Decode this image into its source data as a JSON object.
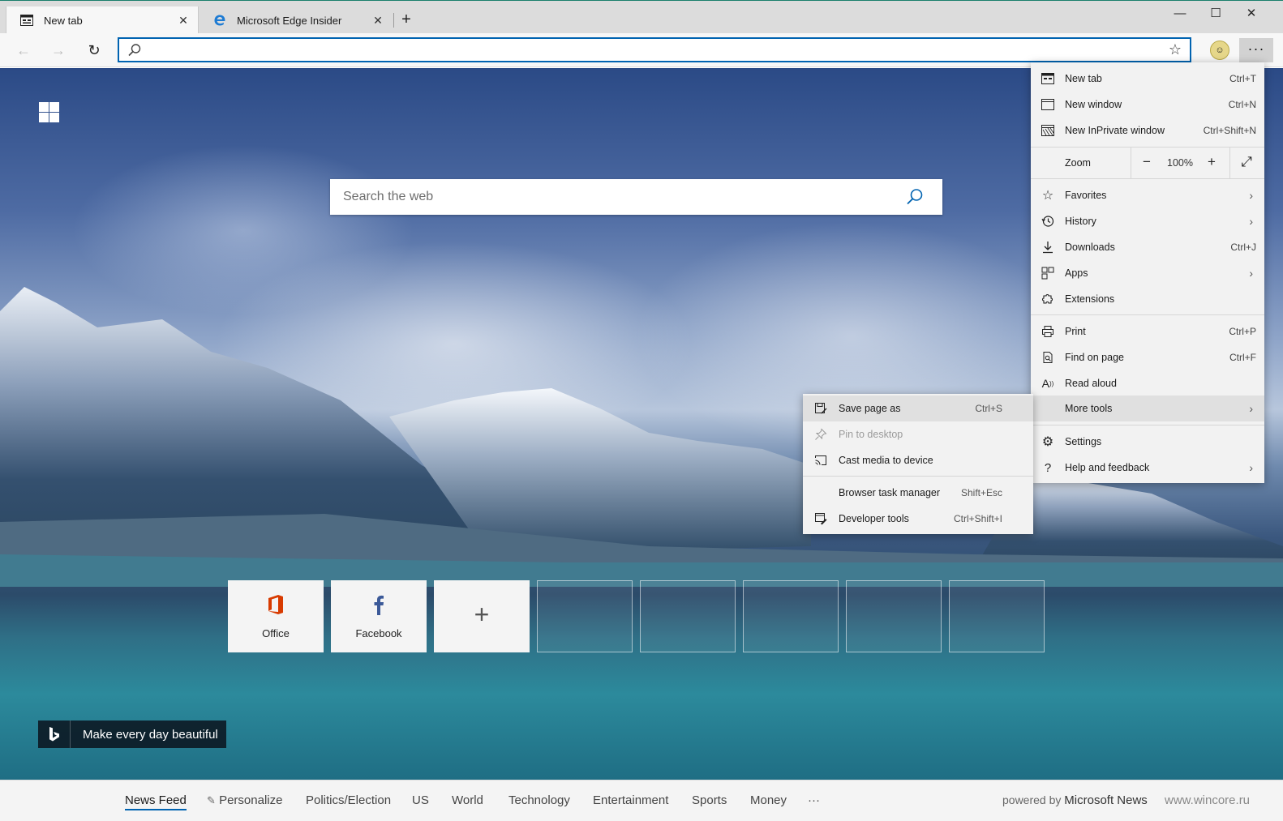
{
  "tabs": [
    {
      "title": "New tab",
      "active": true,
      "icon": "newtab-page-icon"
    },
    {
      "title": "Microsoft Edge Insider",
      "active": false,
      "icon": "edge-logo-icon"
    }
  ],
  "window_controls": {
    "minimize": "—",
    "maximize": "☐",
    "close": "✕"
  },
  "toolbar": {
    "back": "←",
    "forward": "→",
    "refresh": "↻",
    "address_value": "",
    "favorite_star": "☆",
    "more": "···"
  },
  "new_tab_page": {
    "search_placeholder": "Search the web",
    "top_sites": [
      {
        "label": "Office",
        "type": "site"
      },
      {
        "label": "Facebook",
        "type": "site"
      },
      {
        "label": "+",
        "type": "add"
      },
      {
        "label": "",
        "type": "empty"
      },
      {
        "label": "",
        "type": "empty"
      },
      {
        "label": "",
        "type": "empty"
      },
      {
        "label": "",
        "type": "empty"
      },
      {
        "label": "",
        "type": "empty"
      }
    ],
    "bing_caption": "Make every day beautiful"
  },
  "news_bar": {
    "items": [
      "News Feed",
      "Personalize",
      "Politics/Election",
      "US",
      "World",
      "Technology",
      "Entertainment",
      "Sports",
      "Money",
      "···"
    ],
    "active": "News Feed",
    "powered_prefix": "powered by",
    "powered_brand": "Microsoft News",
    "watermark": "www.wincore.ru"
  },
  "menu": {
    "items": [
      {
        "label": "New tab",
        "shortcut": "Ctrl+T",
        "icon": "new-tab-icon"
      },
      {
        "label": "New window",
        "shortcut": "Ctrl+N",
        "icon": "window-icon"
      },
      {
        "label": "New InPrivate window",
        "shortcut": "Ctrl+Shift+N",
        "icon": "inprivate-icon"
      },
      {
        "label": "Favorites",
        "chevron": "›",
        "icon": "star-icon"
      },
      {
        "label": "History",
        "chevron": "›",
        "icon": "history-icon"
      },
      {
        "label": "Downloads",
        "shortcut": "Ctrl+J",
        "icon": "download-icon"
      },
      {
        "label": "Apps",
        "chevron": "›",
        "icon": "apps-icon"
      },
      {
        "label": "Extensions",
        "icon": "puzzle-icon"
      },
      {
        "label": "Print",
        "shortcut": "Ctrl+P",
        "icon": "print-icon"
      },
      {
        "label": "Find on page",
        "shortcut": "Ctrl+F",
        "icon": "find-icon"
      },
      {
        "label": "Read aloud",
        "icon": "read-aloud-icon"
      },
      {
        "label": "More tools",
        "chevron": "›",
        "icon": ""
      },
      {
        "label": "Settings",
        "icon": "gear-icon"
      },
      {
        "label": "Help and feedback",
        "chevron": "›",
        "icon": "question-icon"
      }
    ],
    "zoom": {
      "label": "Zoom",
      "minus": "−",
      "value": "100%",
      "plus": "+",
      "fullscreen": "⤢"
    }
  },
  "submenu": {
    "items": [
      {
        "label": "Save page as",
        "shortcut": "Ctrl+S",
        "icon": "save-page-icon",
        "enabled": true
      },
      {
        "label": "Pin to desktop",
        "shortcut": "",
        "icon": "pin-icon",
        "enabled": false
      },
      {
        "label": "Cast media to device",
        "shortcut": "",
        "icon": "cast-icon",
        "enabled": true
      },
      {
        "label": "Browser task manager",
        "shortcut": "Shift+Esc",
        "icon": "",
        "enabled": true
      },
      {
        "label": "Developer tools",
        "shortcut": "Ctrl+Shift+I",
        "icon": "devtools-icon",
        "enabled": true
      }
    ]
  },
  "colors": {
    "accent": "#0063b1",
    "office": "#d83b01",
    "facebook": "#3b5998"
  }
}
